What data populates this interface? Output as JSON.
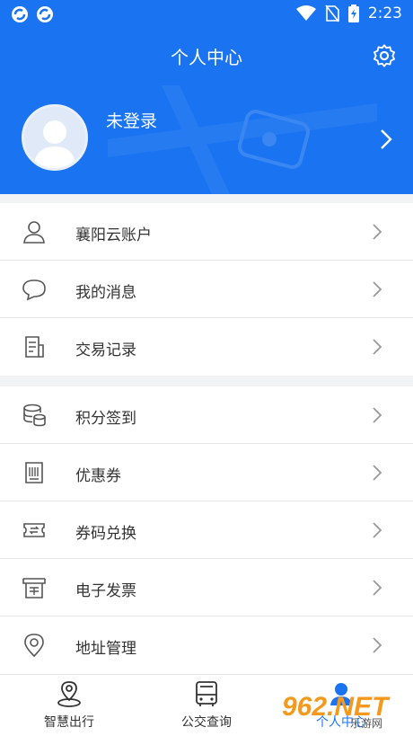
{
  "status_bar": {
    "time": "2:23",
    "icons": [
      "app-notification-icon",
      "app-notification-icon",
      "wifi-icon",
      "no-sim-icon",
      "battery-charging-icon"
    ]
  },
  "header": {
    "title": "个人中心",
    "settings_icon": "gear-icon"
  },
  "profile": {
    "login_text": "未登录",
    "avatar_icon": "default-avatar-icon"
  },
  "menu_group_1": [
    {
      "label": "襄阳云账户",
      "icon": "user-icon"
    },
    {
      "label": "我的消息",
      "icon": "message-icon"
    },
    {
      "label": "交易记录",
      "icon": "document-icon"
    }
  ],
  "menu_group_2": [
    {
      "label": "积分签到",
      "icon": "coins-icon"
    },
    {
      "label": "优惠券",
      "icon": "receipt-icon"
    },
    {
      "label": "券码兑换",
      "icon": "ticket-exchange-icon"
    },
    {
      "label": "电子发票",
      "icon": "invoice-icon"
    },
    {
      "label": "地址管理",
      "icon": "location-pin-icon"
    }
  ],
  "bottom_nav": [
    {
      "label": "智慧出行",
      "icon": "map-pin-icon"
    },
    {
      "label": "公交查询",
      "icon": "bus-icon"
    },
    {
      "label": "个人中心",
      "icon": "profile-icon"
    }
  ],
  "watermark": {
    "text": "962.NET",
    "sub": "乐游网"
  },
  "colors": {
    "primary": "#1a73f0",
    "background": "#f2f3f5",
    "text": "#333333",
    "watermark": "#f39a1e"
  }
}
